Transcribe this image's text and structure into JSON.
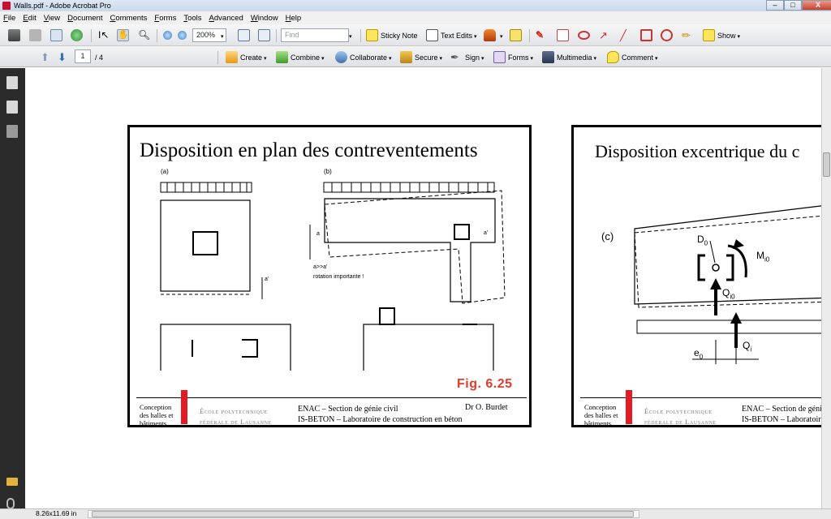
{
  "window": {
    "title": "Walls.pdf - Adobe Acrobat Pro",
    "controls": {
      "minimize": "–",
      "maximize": "□",
      "close": "X"
    }
  },
  "menu": [
    "File",
    "Edit",
    "View",
    "Document",
    "Comments",
    "Forms",
    "Tools",
    "Advanced",
    "Window",
    "Help"
  ],
  "toolbar": {
    "zoom": "200%",
    "find_placeholder": "Find",
    "sticky_note": "Sticky Note",
    "text_edits": "Text Edits",
    "show": "Show"
  },
  "tasks": {
    "page_current": "1",
    "page_total": "/ 4",
    "create": "Create",
    "combine": "Combine",
    "collaborate": "Collaborate",
    "secure": "Secure",
    "sign": "Sign",
    "forms": "Forms",
    "multimedia": "Multimedia",
    "comment": "Comment"
  },
  "status": {
    "page_size": "8.26x11.69 in"
  },
  "slide1": {
    "title": "Disposition en plan des contreventements",
    "label_a": "(a)",
    "label_b": "(b)",
    "note_line1": "a>>a' ",
    "note_line2": "rotation importante !",
    "dim_a": "a",
    "dim_a_prime": "a'",
    "fig": "Fig. 6.25"
  },
  "slide2": {
    "title": "Disposition excentrique du c",
    "label_c": "(c)",
    "d0": "D",
    "d0_sub": "0",
    "m": "M",
    "m_sub": "i0",
    "q0": "Q",
    "q0_sub": "i0",
    "qi": "Q",
    "qi_sub": "i",
    "e0": "e",
    "e0_sub": "0"
  },
  "footer": {
    "course_l1": "Conception",
    "course_l2": "des halles et",
    "course_l3": "bâtiments",
    "ecole_l1": "École polytechnique",
    "ecole_l2": "fédérale de Lausanne",
    "enac_l1": "ENAC – Section de génie civil",
    "enac_l2": "IS-BETON – Laboratoire de construction en béton",
    "enac2_l1": "ENAC – Section de génie",
    "enac2_l2": "IS-BETON – Laboratoire",
    "author": "Dr O. Burdet"
  },
  "colors": {
    "accent_red": "#e31b23",
    "fig_red": "#e33b2a"
  }
}
